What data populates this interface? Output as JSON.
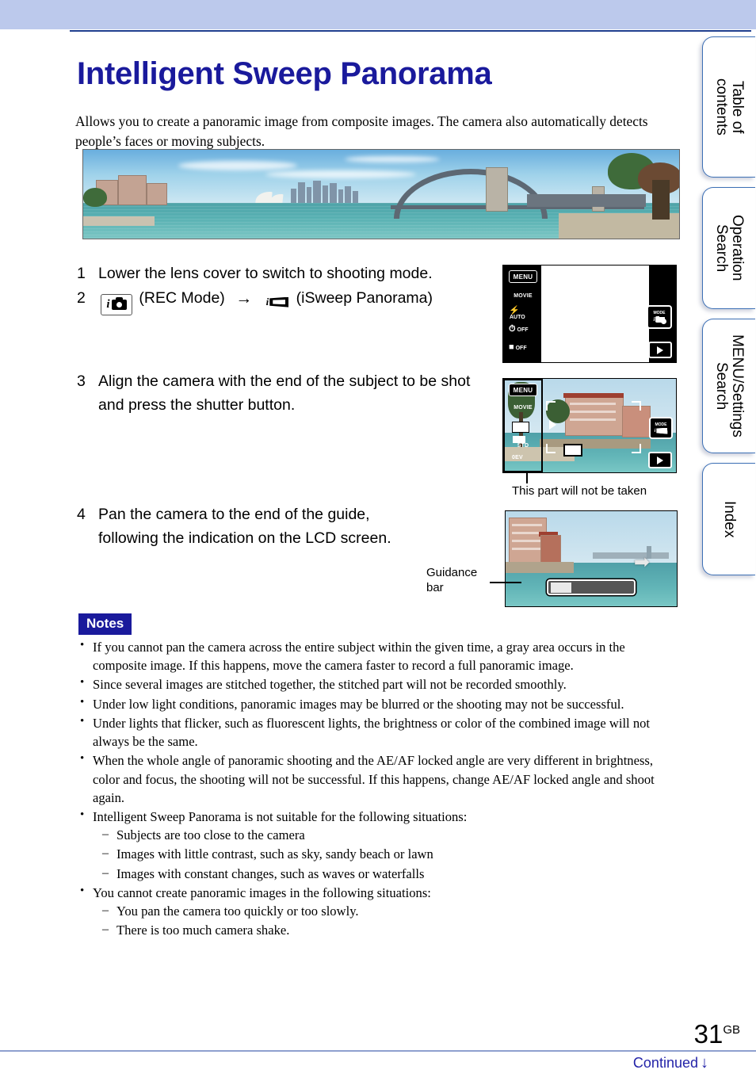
{
  "document": {
    "title": "Intelligent Sweep Panorama",
    "intro": "Allows you to create a panoramic image from composite images. The camera also automatically detects people’s faces or moving subjects.",
    "page_number": "31",
    "page_number_suffix": "GB",
    "continued_label": "Continued",
    "continued_arrow": "↓"
  },
  "side_tabs": [
    {
      "label": "Table of\ncontents"
    },
    {
      "label": "Operation\nSearch"
    },
    {
      "label": "MENU/Settings\nSearch"
    },
    {
      "label": "Index"
    }
  ],
  "steps": [
    {
      "num": "1",
      "text": "Lower the lens cover to switch to shooting mode."
    },
    {
      "num": "2",
      "rec_mode_label": "(REC Mode)",
      "arrow": "→",
      "target_label": "(iSweep Panorama)",
      "rec_icon_letter": "i",
      "pano_icon_letter": "i"
    },
    {
      "num": "3",
      "text": "Align the camera with the end of the subject to be shot and press the shutter button."
    },
    {
      "num": "4",
      "text": "Pan the camera to the end of the guide, following the indication on the LCD screen."
    }
  ],
  "lcd_screens": {
    "screen1": {
      "menu_label": "MENU",
      "items": [
        {
          "label": "MOVIE"
        },
        {
          "label": "AUTO"
        },
        {
          "label": "OFF"
        },
        {
          "label": "OFF"
        }
      ],
      "mode_button_caption": "MODE",
      "play_button": "play-icon"
    },
    "screen2": {
      "menu_label": "MENU",
      "items": [
        {
          "label": "MOVIE"
        },
        {
          "label": ""
        },
        {
          "label": "STD"
        },
        {
          "label": "0EV"
        }
      ],
      "mode_button_caption": "MODE"
    },
    "screen3": {
      "pan_arrow": "➡"
    }
  },
  "callouts": {
    "not_taken": "This part will not be taken",
    "guidance_bar": "Guidance\nbar"
  },
  "notes": {
    "heading": "Notes",
    "items": [
      {
        "text": "If you cannot pan the camera across the entire subject within the given time, a gray area occurs in the composite image. If this happens, move the camera faster to record a full panoramic image."
      },
      {
        "text": "Since several images are stitched together, the stitched part will not be recorded smoothly."
      },
      {
        "text": "Under low light conditions, panoramic images may be blurred or the shooting may not be successful."
      },
      {
        "text": "Under lights that flicker, such as fluorescent lights, the brightness or color of the combined image will not always be the same."
      },
      {
        "text": "When the whole angle of panoramic shooting and the AE/AF locked angle are very different in brightness, color and focus, the shooting will not be successful. If this happens, change AE/AF locked angle and shoot again."
      },
      {
        "text": "Intelligent Sweep Panorama is not suitable for the following situations:",
        "sub": [
          "Subjects are too close to the camera",
          "Images with little contrast, such as sky, sandy beach or lawn",
          "Images with constant changes, such as waves or waterfalls"
        ]
      },
      {
        "text": "You cannot create panoramic images in the following situations:",
        "sub": [
          "You pan the camera too quickly or too slowly.",
          "There is too much camera shake."
        ]
      }
    ]
  },
  "colors": {
    "header_band": "#bcc9ec",
    "title_blue": "#1a1a9c",
    "notes_badge": "#1a1a9c",
    "tab_border": "#3c6fb5",
    "continued_blue": "#2323a8"
  }
}
